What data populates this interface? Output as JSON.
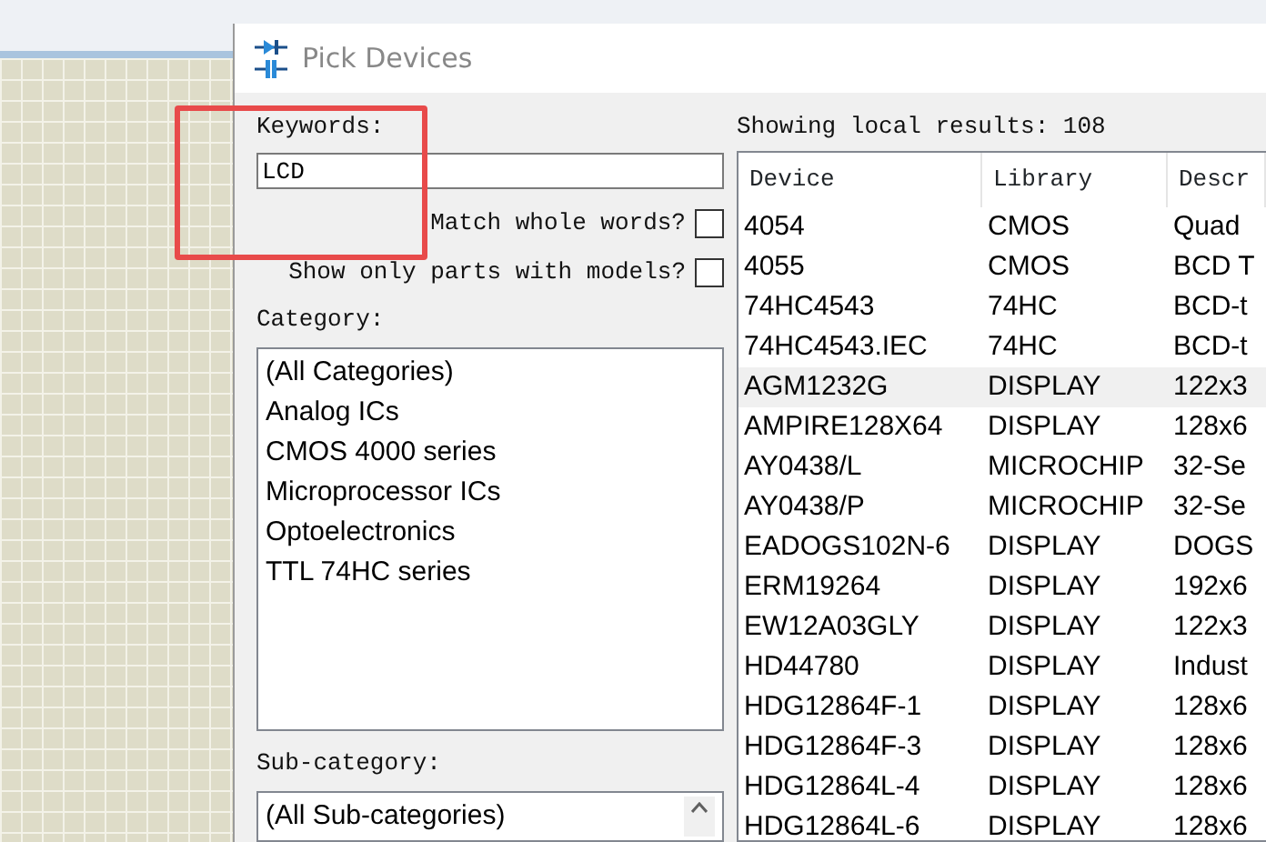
{
  "window": {
    "title": "Pick Devices"
  },
  "keywords": {
    "label": "Keywords:",
    "value": "LCD"
  },
  "options": [
    {
      "label": "Match whole words?",
      "checked": false
    },
    {
      "label": "Show only parts with models?",
      "checked": false
    }
  ],
  "category": {
    "label": "Category:",
    "items": [
      {
        "label": "(All Categories)",
        "selected": false
      },
      {
        "label": "Analog ICs",
        "selected": false
      },
      {
        "label": "CMOS 4000 series",
        "selected": false
      },
      {
        "label": "Microprocessor ICs",
        "selected": false
      },
      {
        "label": "Optoelectronics",
        "selected": false
      },
      {
        "label": "TTL 74HC series",
        "selected": false
      }
    ]
  },
  "sub_category": {
    "label": "Sub-category:",
    "items": [
      {
        "label": "(All Sub-categories)",
        "selected": false
      }
    ]
  },
  "results": {
    "summary": "Showing local results: 108",
    "columns": [
      "Device",
      "Library",
      "Descr"
    ],
    "rows": [
      {
        "cells": [
          "4054",
          "CMOS",
          "Quad"
        ],
        "selected": false
      },
      {
        "cells": [
          "4055",
          "CMOS",
          "BCD T"
        ],
        "selected": false
      },
      {
        "cells": [
          "74HC4543",
          "74HC",
          "BCD-t"
        ],
        "selected": false
      },
      {
        "cells": [
          "74HC4543.IEC",
          "74HC",
          "BCD-t"
        ],
        "selected": false
      },
      {
        "cells": [
          "AGM1232G",
          "DISPLAY",
          "122x3"
        ],
        "selected": true
      },
      {
        "cells": [
          "AMPIRE128X64",
          "DISPLAY",
          "128x6"
        ],
        "selected": false
      },
      {
        "cells": [
          "AY0438/L",
          "MICROCHIP",
          "32-Se"
        ],
        "selected": false
      },
      {
        "cells": [
          "AY0438/P",
          "MICROCHIP",
          "32-Se"
        ],
        "selected": false
      },
      {
        "cells": [
          "EADOGS102N-6",
          "DISPLAY",
          "DOGS"
        ],
        "selected": false
      },
      {
        "cells": [
          "ERM19264",
          "DISPLAY",
          "192x6"
        ],
        "selected": false
      },
      {
        "cells": [
          "EW12A03GLY",
          "DISPLAY",
          "122x3"
        ],
        "selected": false
      },
      {
        "cells": [
          "HD44780",
          "DISPLAY",
          "Indust"
        ],
        "selected": false
      },
      {
        "cells": [
          "HDG12864F-1",
          "DISPLAY",
          "128x6"
        ],
        "selected": false
      },
      {
        "cells": [
          "HDG12864F-3",
          "DISPLAY",
          "128x6"
        ],
        "selected": false
      },
      {
        "cells": [
          "HDG12864L-4",
          "DISPLAY",
          "128x6"
        ],
        "selected": false
      },
      {
        "cells": [
          "HDG12864L-6",
          "DISPLAY",
          "128x6"
        ],
        "selected": false
      }
    ]
  },
  "annotation": {
    "kind": "highlight-rectangle"
  }
}
